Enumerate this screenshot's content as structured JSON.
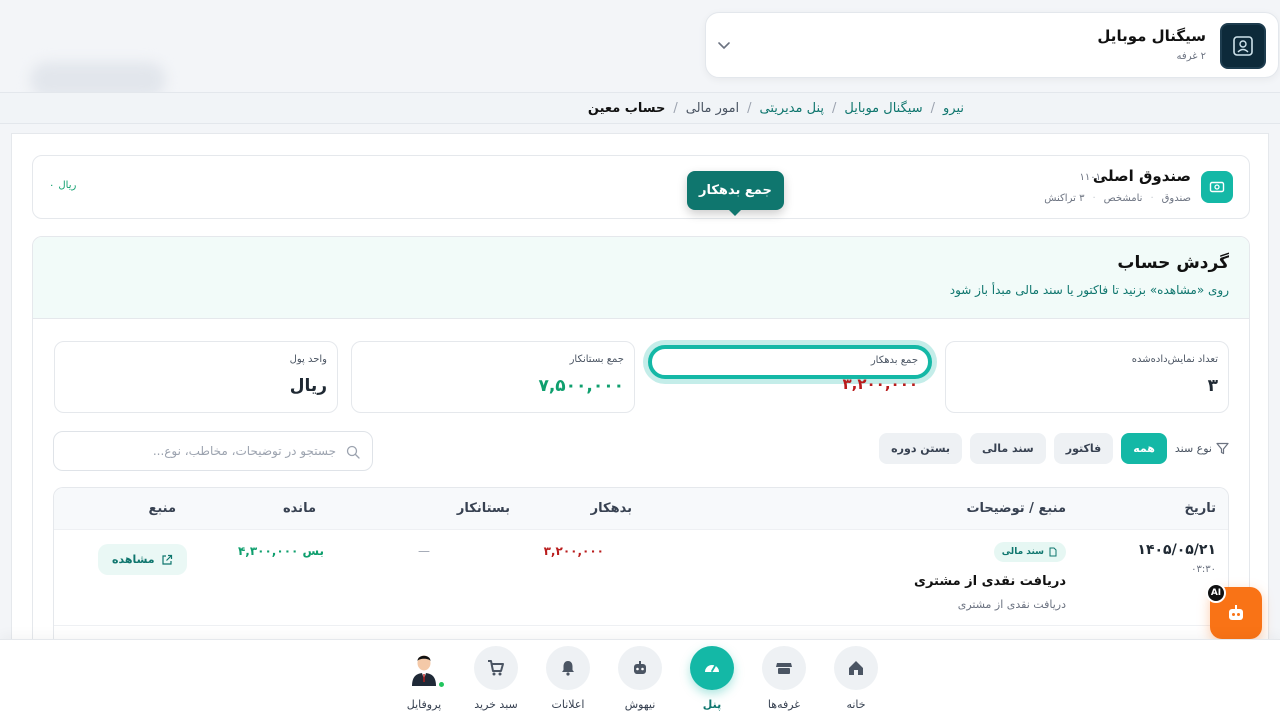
{
  "shop": {
    "name": "سیگنال موبایل",
    "subtitle": "۲ غرفه"
  },
  "breadcrumb": {
    "items": [
      "نیرو",
      "سیگنال موبایل",
      "پنل مدیریتی",
      "امور مالی"
    ],
    "current": "حساب معین",
    "separator": "/"
  },
  "account": {
    "name": "صندوق اصلی",
    "code": "۱۱۰۱",
    "type": "صندوق",
    "status": "نامشخص",
    "transactions": "۳ تراکنش",
    "balance_value": "۰",
    "balance_unit": "ریال"
  },
  "turnover": {
    "title": "گردش حساب",
    "hint": "روی «مشاهده» بزنید تا فاکتور یا سند مالی مبدأ باز شود"
  },
  "stats": {
    "count_label": "تعداد نمایش‌داده‌شده",
    "count_value": "۳",
    "debit_label": "جمع بدهکار",
    "debit_value": "۳,۲۰۰,۰۰۰",
    "credit_label": "جمع بستانکار",
    "credit_value": "۷,۵۰۰,۰۰۰",
    "unit_label": "واحد پول",
    "unit_value": "ریال"
  },
  "tooltip": {
    "text": "جمع بدهکار"
  },
  "filters": {
    "label": "نوع سند",
    "chips": [
      "همه",
      "فاکتور",
      "سند مالی",
      "بستن دوره"
    ]
  },
  "search": {
    "placeholder": "جستجو در توضیحات، مخاطب، نوع..."
  },
  "table": {
    "headers": {
      "date": "تاریخ",
      "source_desc": "منبع / توضیحات",
      "debit": "بدهکار",
      "credit": "بستانکار",
      "balance": "مانده",
      "source": "منبع"
    },
    "rows": [
      {
        "date": "۱۴۰۵/۰۵/۲۱",
        "time": "۰۳:۳۰",
        "badge": "سند مالی",
        "title": "دریافت نقدی از مشتری",
        "desc": "دریافت نقدی از مشتری",
        "debit": "۳,۲۰۰,۰۰۰",
        "credit": "—",
        "balance": "بس ۴,۳۰۰,۰۰۰",
        "action": "مشاهده"
      }
    ]
  },
  "ai": {
    "badge": "AI"
  },
  "nav": {
    "home": "خانه",
    "booths": "غرفه‌ها",
    "panel": "پنل",
    "ai": "نیهوش",
    "notifications": "اعلانات",
    "cart": "سبد خرید",
    "profile": "پروفایل"
  },
  "colors": {
    "accent": "#14b8a6",
    "accent_dark": "#0f766e",
    "debit": "#b91c1c",
    "credit": "#0f9f6e",
    "ai_button": "#f97316"
  }
}
